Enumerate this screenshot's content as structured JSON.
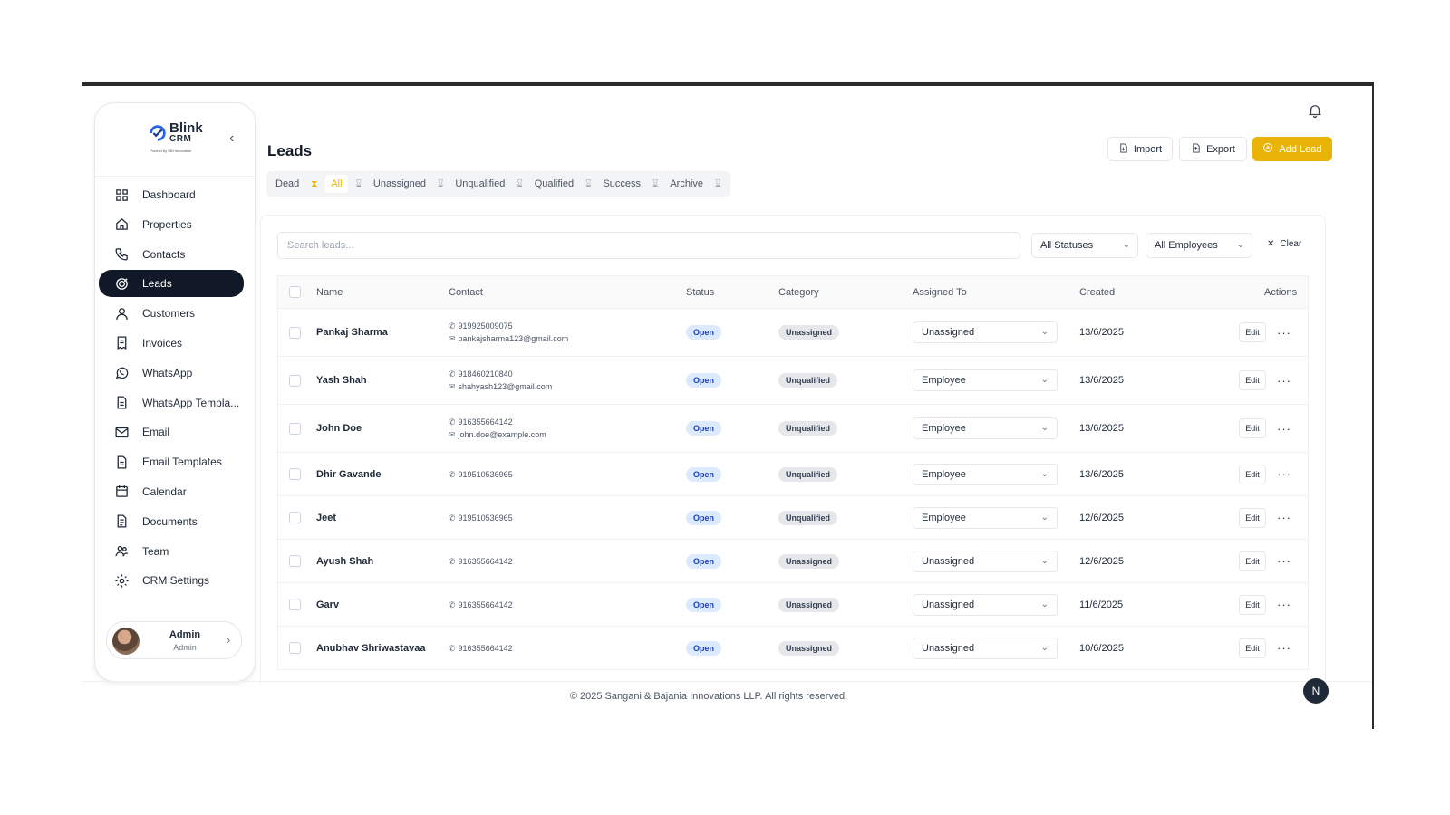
{
  "brand": {
    "name": "Blink",
    "sub": "CRM",
    "tagline": "Product by SBI Innovation"
  },
  "sidebar": {
    "items": [
      {
        "label": "Dashboard",
        "icon": "grid-icon"
      },
      {
        "label": "Properties",
        "icon": "home-icon"
      },
      {
        "label": "Contacts",
        "icon": "phone-icon"
      },
      {
        "label": "Leads",
        "icon": "target-icon",
        "active": true
      },
      {
        "label": "Customers",
        "icon": "user-icon"
      },
      {
        "label": "Invoices",
        "icon": "receipt-icon"
      },
      {
        "label": "WhatsApp",
        "icon": "whatsapp-icon"
      },
      {
        "label": "WhatsApp Templa...",
        "icon": "file-icon"
      },
      {
        "label": "Email",
        "icon": "mail-icon"
      },
      {
        "label": "Email Templates",
        "icon": "file-icon"
      },
      {
        "label": "Calendar",
        "icon": "calendar-icon"
      },
      {
        "label": "Documents",
        "icon": "document-icon"
      },
      {
        "label": "Team",
        "icon": "team-icon"
      },
      {
        "label": "CRM Settings",
        "icon": "gear-icon"
      }
    ],
    "profile": {
      "name": "Admin",
      "role": "Admin"
    }
  },
  "header": {
    "title": "Leads",
    "import_label": "Import",
    "export_label": "Export",
    "add_label": "Add Lead"
  },
  "tabs": [
    "Dead",
    "All",
    "Unassigned",
    "Unqualified",
    "Qualified",
    "Success",
    "Archive"
  ],
  "active_tab": "All",
  "filters": {
    "search_placeholder": "Search leads...",
    "status": "All Statuses",
    "employee": "All Employees",
    "clear_label": "Clear"
  },
  "table": {
    "columns": {
      "name": "Name",
      "contact": "Contact",
      "status": "Status",
      "category": "Category",
      "assigned": "Assigned To",
      "created": "Created",
      "actions": "Actions"
    },
    "edit_label": "Edit",
    "rows": [
      {
        "name": "Pankaj Sharma",
        "phone": "919925009075",
        "email": "pankajsharma123@gmail.com",
        "status": "Open",
        "category": "Unassigned",
        "assigned": "Unassigned",
        "created": "13/6/2025"
      },
      {
        "name": "Yash Shah",
        "phone": "918460210840",
        "email": "shahyash123@gmail.com",
        "status": "Open",
        "category": "Unqualified",
        "assigned": "Employee",
        "created": "13/6/2025"
      },
      {
        "name": "John Doe",
        "phone": "916355664142",
        "email": "john.doe@example.com",
        "status": "Open",
        "category": "Unqualified",
        "assigned": "Employee",
        "created": "13/6/2025"
      },
      {
        "name": "Dhir Gavande",
        "phone": "919510536965",
        "email": "",
        "status": "Open",
        "category": "Unqualified",
        "assigned": "Employee",
        "created": "13/6/2025"
      },
      {
        "name": "Jeet",
        "phone": "919510536965",
        "email": "",
        "status": "Open",
        "category": "Unqualified",
        "assigned": "Employee",
        "created": "12/6/2025"
      },
      {
        "name": "Ayush Shah",
        "phone": "916355664142",
        "email": "",
        "status": "Open",
        "category": "Unassigned",
        "assigned": "Unassigned",
        "created": "12/6/2025"
      },
      {
        "name": "Garv",
        "phone": "916355664142",
        "email": "",
        "status": "Open",
        "category": "Unassigned",
        "assigned": "Unassigned",
        "created": "11/6/2025"
      },
      {
        "name": "Anubhav Shriwastavaa",
        "phone": "916355664142",
        "email": "",
        "status": "Open",
        "category": "Unassigned",
        "assigned": "Unassigned",
        "created": "10/6/2025"
      }
    ]
  },
  "footer": {
    "text": "© 2025 Sangani & Bajania Innovations LLP. All rights reserved."
  },
  "help_badge": "N",
  "colors": {
    "accent": "#eab308",
    "active_nav": "#111827",
    "status_open_bg": "#dbeafe"
  }
}
